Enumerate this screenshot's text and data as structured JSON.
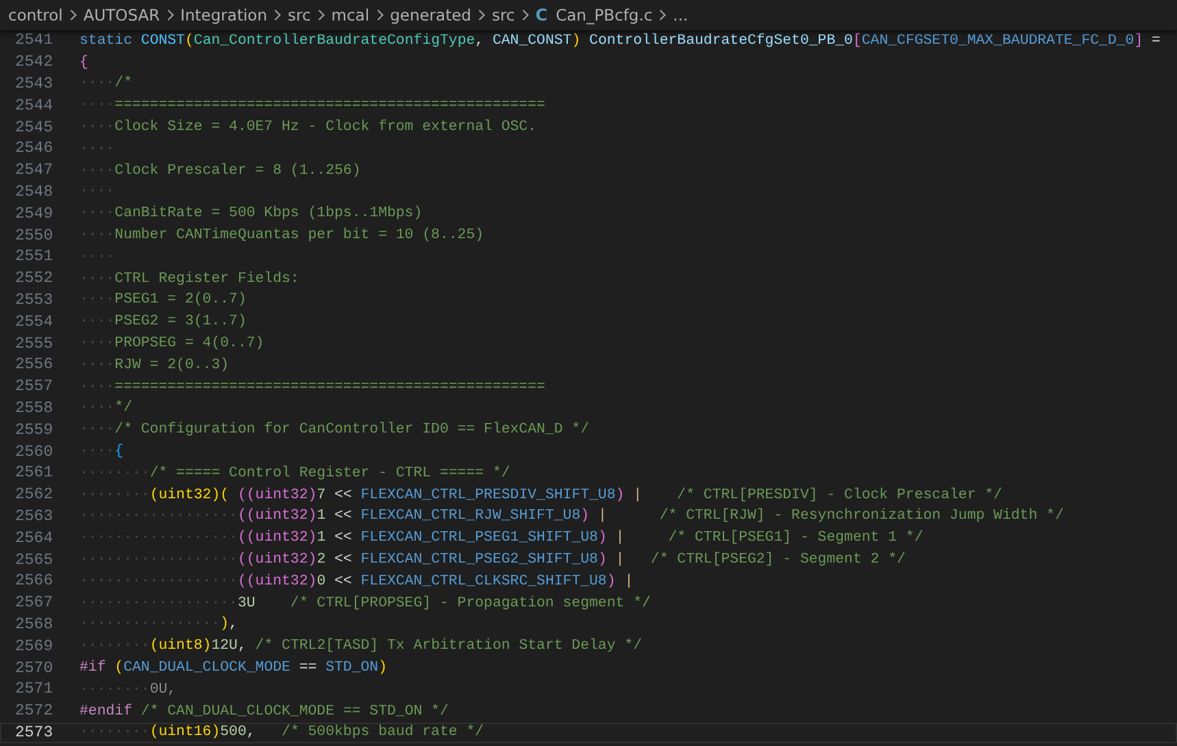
{
  "breadcrumb": {
    "folders": [
      "control",
      "AUTOSAR",
      "Integration",
      "src",
      "mcal",
      "generated",
      "src"
    ],
    "file": {
      "icon": "C",
      "name": "Can_PBcfg.c"
    },
    "overflow": "..."
  },
  "editor": {
    "lines": [
      {
        "number": "2541",
        "current": false,
        "tokens": [
          {
            "kind": "keyword",
            "text": "static "
          },
          {
            "kind": "macro_call",
            "text": "CONST"
          },
          {
            "kind": "level1",
            "text": "("
          },
          {
            "kind": "type",
            "text": "Can_ControllerBaudrateConfigType"
          },
          {
            "kind": "plain",
            "text": ", "
          },
          {
            "kind": "ident",
            "text": "CAN_CONST"
          },
          {
            "kind": "level1",
            "text": ")"
          },
          {
            "kind": "ident",
            "text": " ControllerBaudrateCfgSet0_PB_0"
          },
          {
            "kind": "level2",
            "text": "["
          },
          {
            "kind": "macro",
            "text": "CAN_CFGSET0_MAX_BAUDRATE_FC_D_0"
          },
          {
            "kind": "level2",
            "text": "]"
          },
          {
            "kind": "plain",
            "text": " ="
          }
        ]
      },
      {
        "number": "2542",
        "current": false,
        "tokens": [
          {
            "kind": "level2",
            "text": "{"
          }
        ]
      },
      {
        "number": "2543",
        "current": false,
        "tokens": [
          {
            "kind": "ws",
            "text": "····"
          },
          {
            "kind": "comment",
            "text": "/*"
          }
        ]
      },
      {
        "number": "2544",
        "current": false,
        "tokens": [
          {
            "kind": "ws",
            "text": "····"
          },
          {
            "kind": "comment",
            "text": "================================================="
          }
        ]
      },
      {
        "number": "2545",
        "current": false,
        "tokens": [
          {
            "kind": "ws",
            "text": "····"
          },
          {
            "kind": "comment",
            "text": "Clock Size = 4.0E7 Hz - Clock from external OSC."
          }
        ]
      },
      {
        "number": "2546",
        "current": false,
        "tokens": [
          {
            "kind": "ws",
            "text": "····"
          }
        ]
      },
      {
        "number": "2547",
        "current": false,
        "tokens": [
          {
            "kind": "ws",
            "text": "····"
          },
          {
            "kind": "comment",
            "text": "Clock Prescaler = 8 (1..256)"
          }
        ]
      },
      {
        "number": "2548",
        "current": false,
        "tokens": [
          {
            "kind": "ws",
            "text": "····"
          }
        ]
      },
      {
        "number": "2549",
        "current": false,
        "tokens": [
          {
            "kind": "ws",
            "text": "····"
          },
          {
            "kind": "comment",
            "text": "CanBitRate = 500 Kbps (1bps..1Mbps)"
          }
        ]
      },
      {
        "number": "2550",
        "current": false,
        "tokens": [
          {
            "kind": "ws",
            "text": "····"
          },
          {
            "kind": "comment",
            "text": "Number CANTimeQuantas per bit = 10 (8..25)"
          }
        ]
      },
      {
        "number": "2551",
        "current": false,
        "tokens": [
          {
            "kind": "ws",
            "text": "····"
          }
        ]
      },
      {
        "number": "2552",
        "current": false,
        "tokens": [
          {
            "kind": "ws",
            "text": "····"
          },
          {
            "kind": "comment",
            "text": "CTRL Register Fields:"
          }
        ]
      },
      {
        "number": "2553",
        "current": false,
        "tokens": [
          {
            "kind": "ws",
            "text": "····"
          },
          {
            "kind": "comment",
            "text": "PSEG1 = 2(0..7)"
          }
        ]
      },
      {
        "number": "2554",
        "current": false,
        "tokens": [
          {
            "kind": "ws",
            "text": "····"
          },
          {
            "kind": "comment",
            "text": "PSEG2 = 3(1..7)"
          }
        ]
      },
      {
        "number": "2555",
        "current": false,
        "tokens": [
          {
            "kind": "ws",
            "text": "····"
          },
          {
            "kind": "comment",
            "text": "PROPSEG = 4(0..7)"
          }
        ]
      },
      {
        "number": "2556",
        "current": false,
        "tokens": [
          {
            "kind": "ws",
            "text": "····"
          },
          {
            "kind": "comment",
            "text": "RJW = 2(0..3)"
          }
        ]
      },
      {
        "number": "2557",
        "current": false,
        "tokens": [
          {
            "kind": "ws",
            "text": "····"
          },
          {
            "kind": "comment",
            "text": "================================================="
          }
        ]
      },
      {
        "number": "2558",
        "current": false,
        "tokens": [
          {
            "kind": "ws",
            "text": "····"
          },
          {
            "kind": "comment",
            "text": "*/"
          }
        ]
      },
      {
        "number": "2559",
        "current": false,
        "tokens": [
          {
            "kind": "ws",
            "text": "····"
          },
          {
            "kind": "comment",
            "text": "/* Configuration for CanController ID0 == FlexCAN_D */"
          }
        ]
      },
      {
        "number": "2560",
        "current": false,
        "tokens": [
          {
            "kind": "ws",
            "text": "····"
          },
          {
            "kind": "level3",
            "text": "{"
          }
        ]
      },
      {
        "number": "2561",
        "current": false,
        "tokens": [
          {
            "kind": "ws",
            "text": "········"
          },
          {
            "kind": "comment",
            "text": "/* ===== Control Register - CTRL ===== */"
          }
        ]
      },
      {
        "number": "2562",
        "current": false,
        "tokens": [
          {
            "kind": "ws",
            "text": "········"
          },
          {
            "kind": "level1",
            "text": "(uint32)( "
          },
          {
            "kind": "level2",
            "text": "((uint32)"
          },
          {
            "kind": "number",
            "text": "7"
          },
          {
            "kind": "plain",
            "text": " << "
          },
          {
            "kind": "macro",
            "text": "FLEXCAN_CTRL_PRESDIV_SHIFT_U8"
          },
          {
            "kind": "level2",
            "text": ")"
          },
          {
            "kind": "pipe",
            "text": " |"
          },
          {
            "kind": "comment",
            "text": "    /* CTRL[PRESDIV] - Clock Prescaler */"
          }
        ]
      },
      {
        "number": "2563",
        "current": false,
        "tokens": [
          {
            "kind": "ws",
            "text": "··················"
          },
          {
            "kind": "level2",
            "text": "((uint32)"
          },
          {
            "kind": "number",
            "text": "1"
          },
          {
            "kind": "plain",
            "text": " << "
          },
          {
            "kind": "macro",
            "text": "FLEXCAN_CTRL_RJW_SHIFT_U8"
          },
          {
            "kind": "level2",
            "text": ")"
          },
          {
            "kind": "pipe",
            "text": " |"
          },
          {
            "kind": "comment",
            "text": "      /* CTRL[RJW] - Resynchronization Jump Width */"
          }
        ]
      },
      {
        "number": "2564",
        "current": false,
        "tokens": [
          {
            "kind": "ws",
            "text": "··················"
          },
          {
            "kind": "level2",
            "text": "((uint32)"
          },
          {
            "kind": "number",
            "text": "1"
          },
          {
            "kind": "plain",
            "text": " << "
          },
          {
            "kind": "macro",
            "text": "FLEXCAN_CTRL_PSEG1_SHIFT_U8"
          },
          {
            "kind": "level2",
            "text": ")"
          },
          {
            "kind": "pipe",
            "text": " |"
          },
          {
            "kind": "comment",
            "text": "     /* CTRL[PSEG1] - Segment 1 */"
          }
        ]
      },
      {
        "number": "2565",
        "current": false,
        "tokens": [
          {
            "kind": "ws",
            "text": "··················"
          },
          {
            "kind": "level2",
            "text": "((uint32)"
          },
          {
            "kind": "number",
            "text": "2"
          },
          {
            "kind": "plain",
            "text": " << "
          },
          {
            "kind": "macro",
            "text": "FLEXCAN_CTRL_PSEG2_SHIFT_U8"
          },
          {
            "kind": "level2",
            "text": ")"
          },
          {
            "kind": "pipe",
            "text": " |"
          },
          {
            "kind": "comment",
            "text": "   /* CTRL[PSEG2] - Segment 2 */"
          }
        ]
      },
      {
        "number": "2566",
        "current": false,
        "tokens": [
          {
            "kind": "ws",
            "text": "··················"
          },
          {
            "kind": "level2",
            "text": "((uint32)"
          },
          {
            "kind": "number",
            "text": "0"
          },
          {
            "kind": "plain",
            "text": " << "
          },
          {
            "kind": "macro",
            "text": "FLEXCAN_CTRL_CLKSRC_SHIFT_U8"
          },
          {
            "kind": "level2",
            "text": ")"
          },
          {
            "kind": "pipe",
            "text": " |"
          }
        ]
      },
      {
        "number": "2567",
        "current": false,
        "tokens": [
          {
            "kind": "ws",
            "text": "··················"
          },
          {
            "kind": "number",
            "text": "3U"
          },
          {
            "kind": "comment",
            "text": "    /* CTRL[PROPSEG] - Propagation segment */"
          }
        ]
      },
      {
        "number": "2568",
        "current": false,
        "tokens": [
          {
            "kind": "ws",
            "text": "················"
          },
          {
            "kind": "level1",
            "text": ")"
          },
          {
            "kind": "plain",
            "text": ","
          }
        ]
      },
      {
        "number": "2569",
        "current": false,
        "tokens": [
          {
            "kind": "ws",
            "text": "········"
          },
          {
            "kind": "level1",
            "text": "(uint8)"
          },
          {
            "kind": "number",
            "text": "12U"
          },
          {
            "kind": "plain",
            "text": ", "
          },
          {
            "kind": "comment",
            "text": "/* CTRL2[TASD] Tx Arbitration Start Delay */"
          }
        ]
      },
      {
        "number": "2570",
        "current": false,
        "tokens": [
          {
            "kind": "preproc",
            "text": "#if "
          },
          {
            "kind": "level1",
            "text": "("
          },
          {
            "kind": "macro",
            "text": "CAN_DUAL_CLOCK_MODE"
          },
          {
            "kind": "plain",
            "text": " == "
          },
          {
            "kind": "macro",
            "text": "STD_ON"
          },
          {
            "kind": "level1",
            "text": ")"
          }
        ]
      },
      {
        "number": "2571",
        "current": false,
        "tokens": [
          {
            "kind": "ws",
            "text": "········"
          },
          {
            "kind": "inactive",
            "text": "0U,"
          }
        ]
      },
      {
        "number": "2572",
        "current": false,
        "tokens": [
          {
            "kind": "preproc",
            "text": "#endif "
          },
          {
            "kind": "comment",
            "text": "/* CAN_DUAL_CLOCK_MODE == STD_ON */"
          }
        ]
      },
      {
        "number": "2573",
        "current": true,
        "tokens": [
          {
            "kind": "ws",
            "text": "········"
          },
          {
            "kind": "level1",
            "text": "(uint16)"
          },
          {
            "kind": "number",
            "text": "500"
          },
          {
            "kind": "plain",
            "text": ",   "
          },
          {
            "kind": "comment",
            "text": "/* 500kbps baud rate */"
          }
        ]
      }
    ]
  }
}
